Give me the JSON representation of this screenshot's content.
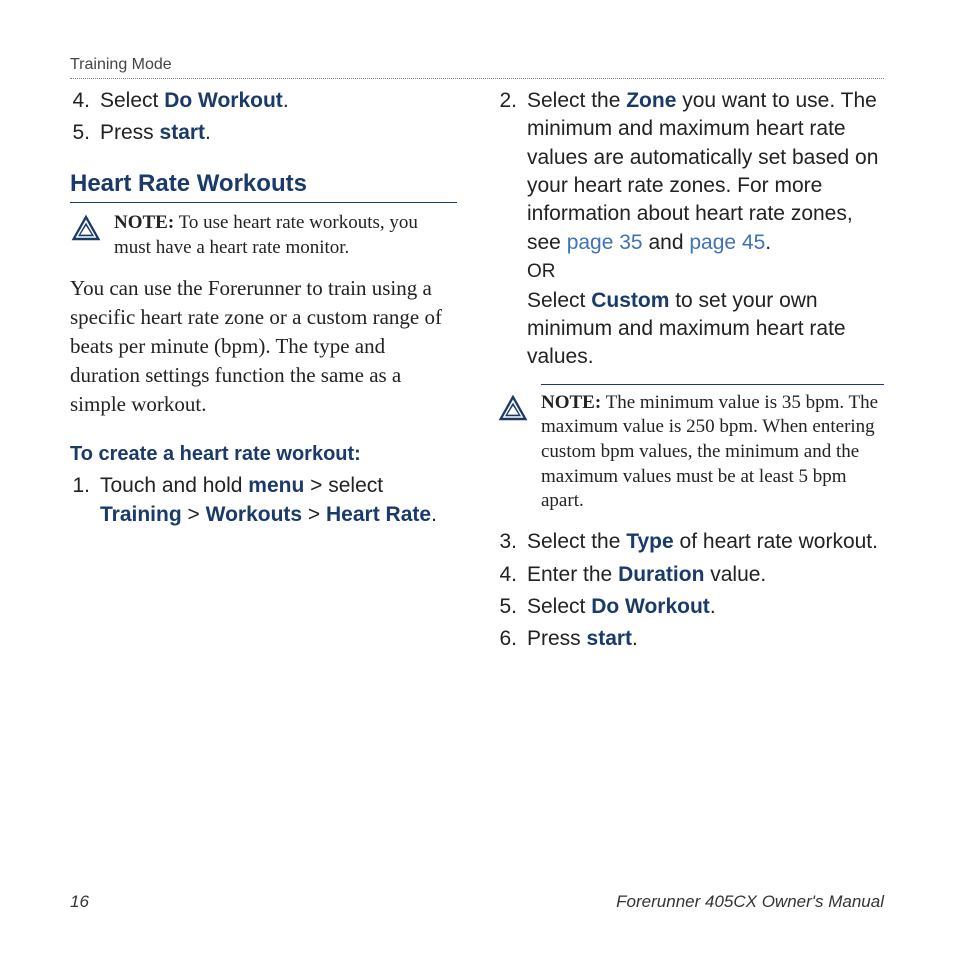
{
  "header": {
    "section": "Training Mode"
  },
  "left": {
    "list_a": [
      {
        "num": "4.",
        "pre": "Select ",
        "bold": "Do Workout",
        "post": "."
      },
      {
        "num": "5.",
        "pre": "Press ",
        "bold": "start",
        "post": "."
      }
    ],
    "heading": "Heart Rate Workouts",
    "note": {
      "label": "NOTE:",
      "text": " To use heart rate workouts, you must have a heart rate monitor."
    },
    "para": "You can use the Forerunner to train using a specific heart rate zone or a custom range of beats per minute (bpm). The type and duration settings function the same as a simple workout.",
    "subheading": "To create a heart rate workout:",
    "step1": {
      "num": "1.",
      "parts": {
        "a": "Touch and hold ",
        "menu": "menu",
        "b": " > select ",
        "training": "Training",
        "c": " > ",
        "workouts": "Workouts",
        "d": " > ",
        "hr": "Heart Rate",
        "e": "."
      }
    }
  },
  "right": {
    "step2": {
      "num": "2.",
      "a": "Select the ",
      "zone": "Zone",
      "b": " you want to use. The minimum and maximum heart rate values are automatically set based on your heart rate zones. For more information about heart rate zones, see ",
      "link1": "page 35",
      "c": " and ",
      "link2": "page 45",
      "d": ".",
      "or": "OR",
      "e": "Select ",
      "custom": "Custom",
      "f": " to set your own minimum and maximum heart rate values."
    },
    "note": {
      "label": "NOTE:",
      "text": " The minimum value is 35 bpm. The maximum value is 250 bpm. When entering custom bpm values, the minimum and the maximum values must be at least 5 bpm apart."
    },
    "steps_rest": [
      {
        "num": "3.",
        "pre": "Select the ",
        "bold": "Type",
        "post": " of heart rate workout."
      },
      {
        "num": "4.",
        "pre": "Enter the ",
        "bold": "Duration",
        "post": " value."
      },
      {
        "num": "5.",
        "pre": "Select ",
        "bold": "Do Workout",
        "post": "."
      },
      {
        "num": "6.",
        "pre": "Press ",
        "bold": "start",
        "post": "."
      }
    ]
  },
  "footer": {
    "page": "16",
    "title": "Forerunner 405CX Owner's Manual"
  }
}
